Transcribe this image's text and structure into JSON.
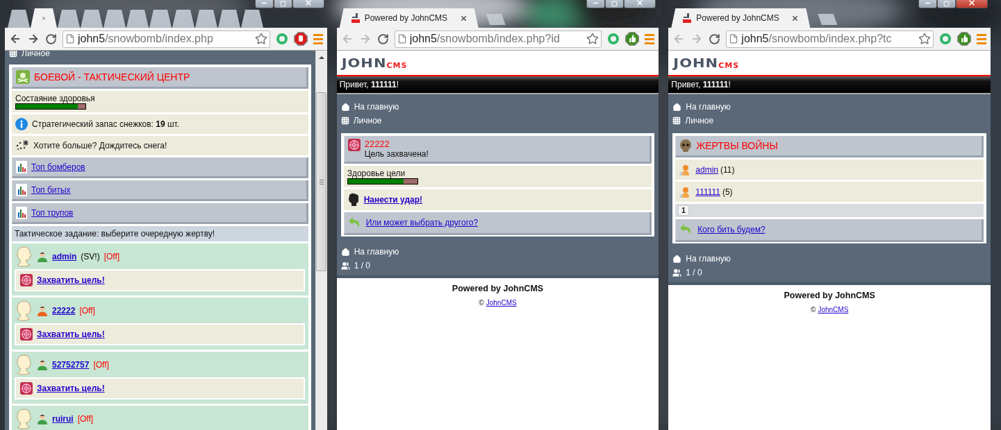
{
  "windows": [
    {
      "active": false,
      "back_enabled": true,
      "forward_enabled": true,
      "extension": {
        "kind": "stop"
      },
      "tabs": [
        {
          "selected": false
        },
        {
          "selected": true
        },
        {
          "selected": false
        },
        {
          "selected": false
        },
        {
          "selected": false
        },
        {
          "selected": false
        },
        {
          "selected": false
        },
        {
          "selected": false
        },
        {
          "selected": false
        },
        {
          "selected": false
        },
        {
          "selected": false
        }
      ],
      "address": {
        "host": "john5",
        "path": "/snowbomb/index.php"
      },
      "scrollbar": true,
      "sections": [
        {
          "kind": "nav",
          "items": [
            {
              "kind": "menu",
              "text": "Личное"
            }
          ]
        },
        {
          "kind": "box",
          "rows": [
            {
              "kind": "combat",
              "title": "БОЕВОЙ - ТАКТИЧЕСКИЙ ЦЕНТР"
            },
            {
              "kind": "meter",
              "label": "Состаяние здоровья",
              "level": 0.89
            },
            {
              "kind": "stock",
              "text": "Стратегический запас снежков: **19** шт."
            },
            {
              "kind": "hint",
              "text": "Хотите больше? Дождитесь снега!"
            },
            {
              "kind": "top",
              "text": "Топ бомберов"
            },
            {
              "kind": "top",
              "text": "Топ битых"
            },
            {
              "kind": "top",
              "text": "Топ трупов"
            },
            {
              "kind": "task",
              "text": "Тактическое задание: выберите очередную жертву!"
            },
            {
              "kind": "player",
              "name": "admin",
              "tag": "(SV!)",
              "status": "[Off]",
              "color": "#43a047",
              "action": "Захватить цель!"
            },
            {
              "kind": "player",
              "name": "22222",
              "status": "[Off]",
              "color": "#e8641e",
              "action": "Захватить цель!"
            },
            {
              "kind": "player",
              "name": "52752757",
              "status": "[Off]",
              "color": "#43a047",
              "action": "Захватить цель!"
            },
            {
              "kind": "player",
              "name": "ruirui",
              "status": "[Off]",
              "color": "#43a047"
            }
          ]
        }
      ]
    },
    {
      "active": false,
      "back_enabled": false,
      "forward_enabled": false,
      "extension": {
        "kind": "thumb"
      },
      "tabs": [
        {
          "title": "Powered by JohnCMS",
          "selected": true
        }
      ],
      "address": {
        "host": "john5",
        "path": "/snowbomb/index.php?id"
      },
      "scrollbar": false,
      "sections": [
        {
          "kind": "logo",
          "word": "JOHN",
          "suffix": "CMS"
        },
        {
          "kind": "greeting",
          "text": "Привет, **111111**!"
        },
        {
          "kind": "nav",
          "items": [
            {
              "kind": "home",
              "text": "На главную"
            },
            {
              "kind": "menu",
              "text": "Личное"
            }
          ]
        },
        {
          "kind": "box",
          "rows": [
            {
              "kind": "target",
              "name": "22222",
              "subtitle": "Цель захвачена!"
            },
            {
              "kind": "meter",
              "label": "Здоровье цели",
              "level": 0.8
            },
            {
              "kind": "strike",
              "text": "Нанести удар!"
            },
            {
              "kind": "back",
              "text": "Или может выбрать другого?"
            }
          ]
        },
        {
          "kind": "nav",
          "items": [
            {
              "kind": "home",
              "text": "На главную"
            },
            {
              "kind": "online",
              "text": "1 / 0"
            }
          ]
        },
        {
          "kind": "footer",
          "powered": "Powered by JohnCMS",
          "sign": "©",
          "link": "JohnCMS"
        }
      ]
    },
    {
      "active": true,
      "back_enabled": false,
      "forward_enabled": false,
      "extension": {
        "kind": "thumb"
      },
      "tabs": [
        {
          "title": "Powered by JohnCMS",
          "selected": true
        }
      ],
      "address": {
        "host": "john5",
        "path": "/snowbomb/index.php?tc"
      },
      "scrollbar": false,
      "sections": [
        {
          "kind": "logo",
          "word": "JOHN",
          "suffix": "CMS"
        },
        {
          "kind": "greeting",
          "text": "Привет, **111111**!"
        },
        {
          "kind": "nav",
          "items": [
            {
              "kind": "home",
              "text": "На главную"
            },
            {
              "kind": "menu",
              "text": "Личное"
            }
          ]
        },
        {
          "kind": "box",
          "rows": [
            {
              "kind": "victims",
              "title": "ЖЕРТВЫ ВОЙНЫ"
            },
            {
              "kind": "victim",
              "name": "admin",
              "count": "(11)"
            },
            {
              "kind": "victim",
              "name": "111111",
              "count": "(5)"
            },
            {
              "kind": "pager",
              "pages": [
                {
                  "label": "1"
                }
              ]
            },
            {
              "kind": "back",
              "text": "Кого бить будем?"
            }
          ]
        },
        {
          "kind": "nav",
          "items": [
            {
              "kind": "home",
              "text": "На главную"
            },
            {
              "kind": "online",
              "text": "1 / 0"
            }
          ]
        },
        {
          "kind": "footer",
          "powered": "Powered by JohnCMS",
          "sign": "©",
          "link": "JohnCMS"
        }
      ]
    }
  ]
}
